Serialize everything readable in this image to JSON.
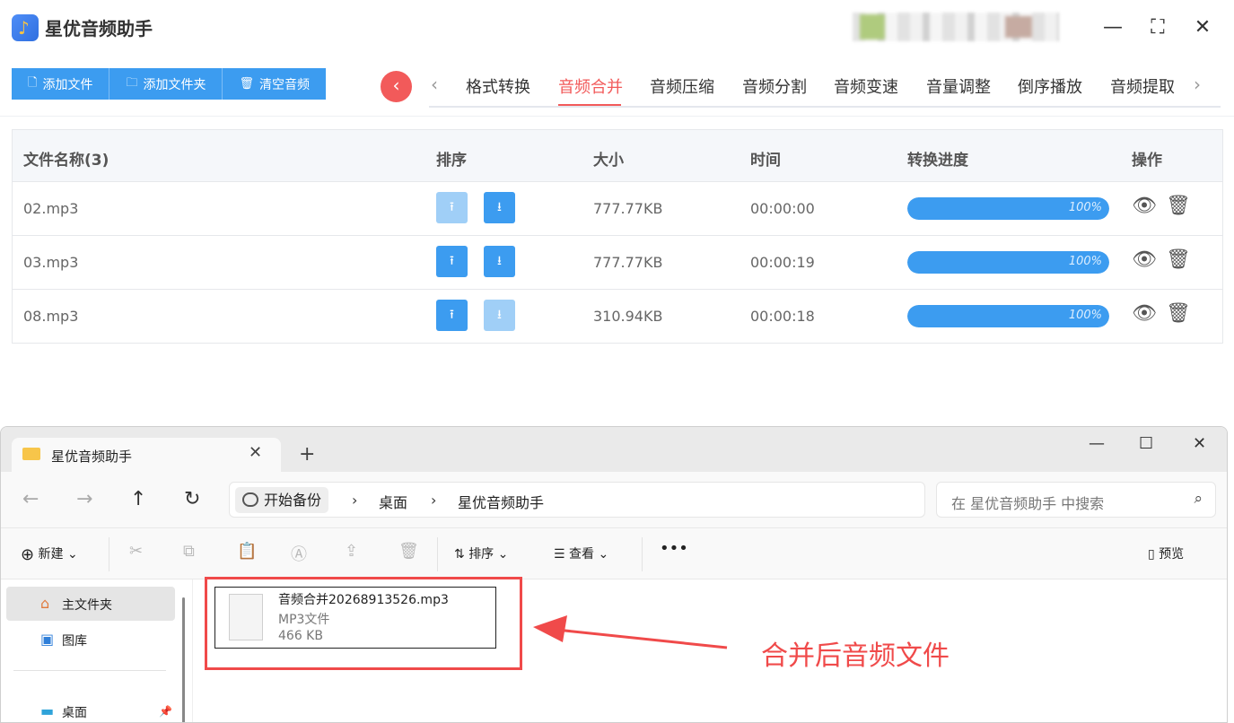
{
  "app": {
    "title": "星优音频助手",
    "toolbar": {
      "add_file": "添加文件",
      "add_folder": "添加文件夹",
      "clear": "清空音频"
    },
    "tabs": [
      "格式转换",
      "音频合并",
      "音频压缩",
      "音频分割",
      "音频变速",
      "音量调整",
      "倒序播放",
      "音频提取"
    ],
    "active_tab": "音频合并",
    "table": {
      "headers": {
        "name": "文件名称(3)",
        "order": "排序",
        "size": "大小",
        "time": "时间",
        "progress": "转换进度",
        "ops": "操作"
      },
      "rows": [
        {
          "name": "02.mp3",
          "size": "777.77KB",
          "time": "00:00:00",
          "progress_label": "100%",
          "progress": 1.0,
          "up_enabled": false,
          "down_enabled": true
        },
        {
          "name": "03.mp3",
          "size": "777.77KB",
          "time": "00:00:19",
          "progress_label": "100%",
          "progress": 1.0,
          "up_enabled": true,
          "down_enabled": true
        },
        {
          "name": "08.mp3",
          "size": "310.94KB",
          "time": "00:00:18",
          "progress_label": "100%",
          "progress": 1.0,
          "up_enabled": true,
          "down_enabled": false
        }
      ]
    },
    "colors": {
      "accent": "#3c9cf0",
      "active_tab": "#f25a5a"
    }
  },
  "explorer": {
    "tab_title": "星优音频助手",
    "address": {
      "backup": "开始备份",
      "crumbs": [
        "桌面",
        "星优音频助手"
      ]
    },
    "search_placeholder": "在 星优音频助手 中搜索",
    "commands": {
      "new": "新建",
      "sort": "排序",
      "view": "查看",
      "preview": "预览"
    },
    "sidebar": [
      "主文件夹",
      "图库",
      "桌面"
    ],
    "file": {
      "name": "音频合并20268913526.mp3",
      "type": "MP3文件",
      "size": "466 KB"
    }
  },
  "annotation": {
    "text": "合并后音频文件",
    "color": "#f04a4a"
  }
}
